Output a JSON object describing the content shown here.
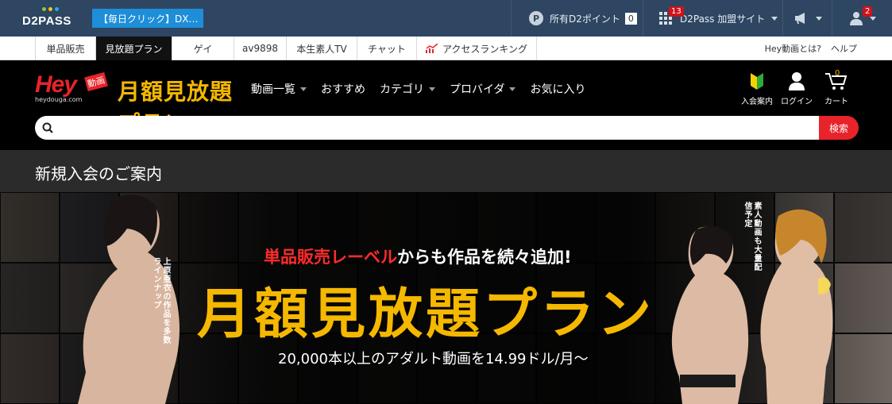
{
  "topbar": {
    "logo_text": "D2PASS",
    "daily_click": "【毎日クリック】DX…",
    "points_icon": "P",
    "points_label": "所有D2ポイント",
    "points_value": "0",
    "sites_badge": "13",
    "sites_label": "D2Pass 加盟サイト",
    "user_badge": "2"
  },
  "nav": {
    "tabs": [
      "単品販売",
      "見放題プラン",
      "ゲイ",
      "av9898",
      "本生素人TV",
      "チャット",
      "アクセスランキング"
    ],
    "right_links": [
      "Hey動画とは?",
      "ヘルプ"
    ]
  },
  "header": {
    "logo_hey": "Hey",
    "logo_douga": "動画",
    "logo_url": "heydouga.com",
    "logo_plan": "月額見放題プラン",
    "menu": [
      "動画一覧",
      "おすすめ",
      "カテゴリ",
      "プロバイダ",
      "お気に入り"
    ],
    "icons": [
      "入会案内",
      "ログイン",
      "カート"
    ],
    "cart_count": "0",
    "search_placeholder": "",
    "search_button": "検索"
  },
  "page": {
    "title": "新規入会のご案内"
  },
  "banner": {
    "headline_red": "単品販売レーベル",
    "headline_white": "からも作品を続々追加!",
    "main_title": "月額見放題プラン",
    "sub_title": "20,000本以上のアダルト動画を14.99ドル/月〜",
    "left_note": "上原亜衣の作品を多数ラインナップ",
    "right_note": "素人動画も大量配信予定"
  },
  "colors": {
    "topbar": "#2e4661",
    "daily_button": "#1e8ed8",
    "brand_red": "#e8232a",
    "brand_yellow": "#f5b800"
  }
}
